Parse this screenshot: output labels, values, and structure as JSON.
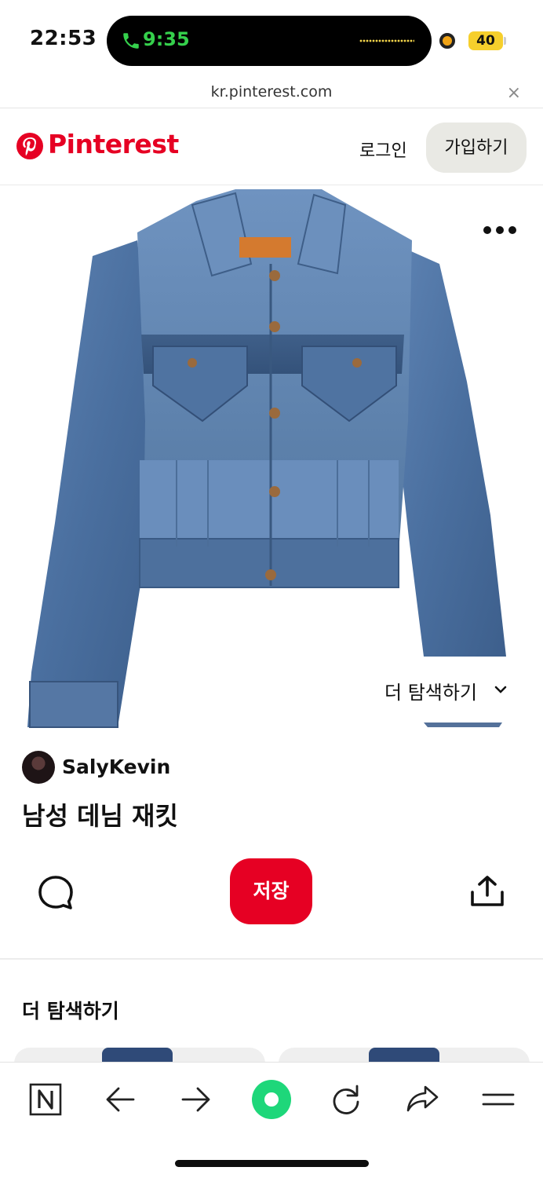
{
  "status_bar": {
    "time": "22:53",
    "call_time": "9:35",
    "battery": "40"
  },
  "browser": {
    "url": "kr.pinterest.com",
    "close_glyph": "×"
  },
  "header": {
    "logo_text": "Pinterest",
    "login_label": "로그인",
    "signup_label": "가입하기",
    "brand_color": "#e60023"
  },
  "pin": {
    "image_icon": "denim-jacket-photo",
    "explore_more_label": "더 탐색하기",
    "author_name": "SalyKevin",
    "title": "남성 데님 재킷",
    "save_label": "저장"
  },
  "related": {
    "section_title": "더 탐색하기"
  },
  "toolbar": {
    "icons": [
      "notion-icon",
      "back-arrow-icon",
      "forward-arrow-icon",
      "record-icon",
      "reload-icon",
      "share-icon",
      "menu-icon"
    ]
  }
}
